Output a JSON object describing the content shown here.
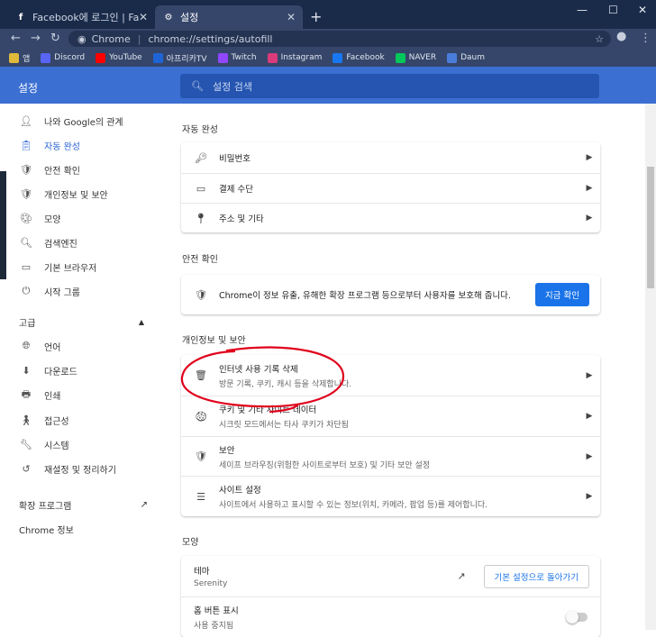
{
  "tabs": [
    {
      "title": "Facebook에 로그인 | Facebook",
      "icon": "facebook-icon"
    },
    {
      "title": "설정",
      "icon": "settings-icon"
    }
  ],
  "address": {
    "site": "Chrome",
    "url": "chrome://settings/autofill"
  },
  "bookmarks": [
    {
      "label": "앱",
      "color": "#e0b93c"
    },
    {
      "label": "Discord",
      "color": "#5865f2"
    },
    {
      "label": "YouTube",
      "color": "#ff0000"
    },
    {
      "label": "아프리카TV",
      "color": "#1f64d6"
    },
    {
      "label": "Twitch",
      "color": "#9146ff"
    },
    {
      "label": "Instagram",
      "color": "#d93b7a"
    },
    {
      "label": "Facebook",
      "color": "#1877f2"
    },
    {
      "label": "NAVER",
      "color": "#03c75a"
    },
    {
      "label": "Daum",
      "color": "#4a7cdb"
    }
  ],
  "header": {
    "title": "설정",
    "search_placeholder": "설정 검색"
  },
  "sidebar": {
    "items": [
      {
        "label": "나와 Google의 관계",
        "icon": "person-icon"
      },
      {
        "label": "자동 완성",
        "icon": "clipboard-icon"
      },
      {
        "label": "안전 확인",
        "icon": "shield-check-icon"
      },
      {
        "label": "개인정보 및 보안",
        "icon": "shield-icon"
      },
      {
        "label": "모양",
        "icon": "palette-icon"
      },
      {
        "label": "검색엔진",
        "icon": "search-icon"
      },
      {
        "label": "기본 브라우저",
        "icon": "browser-icon"
      },
      {
        "label": "시작 그룹",
        "icon": "power-icon"
      }
    ],
    "advanced": "고급",
    "adv_items": [
      {
        "label": "언어",
        "icon": "globe-icon"
      },
      {
        "label": "다운로드",
        "icon": "download-icon"
      },
      {
        "label": "인쇄",
        "icon": "print-icon"
      },
      {
        "label": "접근성",
        "icon": "accessibility-icon"
      },
      {
        "label": "시스템",
        "icon": "wrench-icon"
      },
      {
        "label": "재설정 및 정리하기",
        "icon": "reset-icon"
      }
    ],
    "extensions": "확장 프로그램",
    "about": "Chrome 정보"
  },
  "autofill": {
    "title": "자동 완성",
    "rows": [
      {
        "label": "비밀번호",
        "icon": "key-icon"
      },
      {
        "label": "결제 수단",
        "icon": "credit-card-icon"
      },
      {
        "label": "주소 및 기타",
        "icon": "location-icon"
      }
    ]
  },
  "safety": {
    "title": "안전 확인",
    "text": "Chrome이 정보 유출, 유해한 확장 프로그램 등으로부터 사용자를 보호해 줍니다.",
    "button": "지금 확인"
  },
  "privacy": {
    "title": "개인정보 및 보안",
    "rows": [
      {
        "label": "인터넷 사용 기록 삭제",
        "sub": "방문 기록, 쿠키, 캐시 등을 삭제합니다.",
        "icon": "trash-icon"
      },
      {
        "label": "쿠키 및 기타 사이트 데이터",
        "sub": "시크릿 모드에서는 타사 쿠키가 차단됨",
        "icon": "cookie-icon"
      },
      {
        "label": "보안",
        "sub": "세이프 브라우징(위험한 사이트로부터 보호) 및 기타 보안 설정",
        "icon": "shield-icon"
      },
      {
        "label": "사이트 설정",
        "sub": "사이트에서 사용하고 표시할 수 있는 정보(위치, 카메라, 팝업 등)를 제어합니다.",
        "icon": "sliders-icon"
      }
    ]
  },
  "appearance": {
    "title": "모양",
    "theme_label": "테마",
    "theme_value": "Serenity",
    "reset_button": "기본 설정으로 돌아가기",
    "home_label": "홈 버튼 표시",
    "home_sub": "사용 중지됨"
  },
  "colors": {
    "accent": "#1a73e8",
    "annotation": "#e0001b"
  }
}
